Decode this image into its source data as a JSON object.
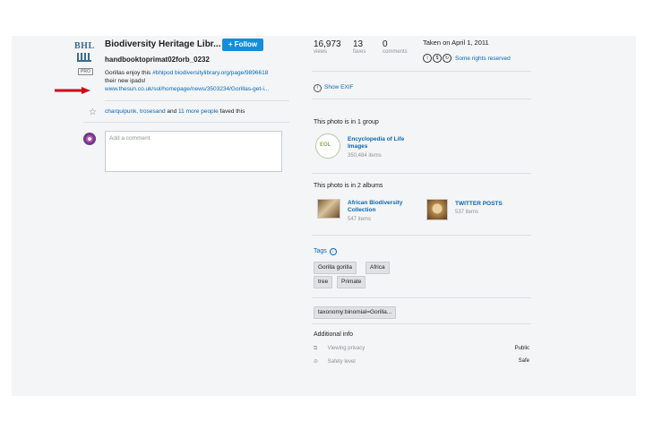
{
  "owner": {
    "name": "Biodiversity Heritage Libr...",
    "logo_text": "BHL",
    "pro_badge": "PRO",
    "follow_label": "+ Follow"
  },
  "photo": {
    "title": "handbooktoprimat02forb_0232",
    "description_prefix": "Gorillas enjoy this ",
    "description_link": "#bhlpod biodiversitylibrary.org/page/9896618",
    "description_suffix": "their new ipads!",
    "description_url": "www.thesun.co.uk/sol/homepage/news/3503234/Gorillas-get-i..."
  },
  "faves": {
    "names": "charquipunk, trosesand",
    "middle": " and ",
    "more": "11 more people",
    "suffix": " faved this"
  },
  "comment": {
    "placeholder": "Add a comment"
  },
  "stats": {
    "views": {
      "value": "16,973",
      "label": "views"
    },
    "faves": {
      "value": "13",
      "label": "faves"
    },
    "comments": {
      "value": "0",
      "label": "comments"
    }
  },
  "taken": "Taken on April 1, 2011",
  "license": {
    "label": "Some rights reserved",
    "icons": [
      "cc-by-icon",
      "cc-nc-icon",
      "cc-sa-icon"
    ]
  },
  "exif": {
    "label": "Show EXIF"
  },
  "groups": {
    "heading": "This photo is in 1 group",
    "items": [
      {
        "title": "Encyclopedia of Life Images",
        "count": "350,484 items",
        "thumb_text": "EOL"
      }
    ]
  },
  "albums": {
    "heading": "This photo is in 2 albums",
    "items": [
      {
        "title": "African Biodiversity Collection",
        "count": "547 items"
      },
      {
        "title": "TWITTER POSTS",
        "count": "537 items"
      }
    ]
  },
  "tags": {
    "label": "Tags",
    "items": [
      "Gorilla gorilla",
      "Africa",
      "tree",
      "Primate"
    ],
    "machine_tag": "taxonomy:binomial=Gorilla..."
  },
  "additional": {
    "heading": "Additional info",
    "rows": [
      {
        "label": "Viewing privacy",
        "value": "Public"
      },
      {
        "label": "Safety level",
        "value": "Safe"
      }
    ]
  },
  "colors": {
    "accent": "#128fdc",
    "link": "#0b67b2",
    "annotation_arrow": "#d0021b"
  }
}
